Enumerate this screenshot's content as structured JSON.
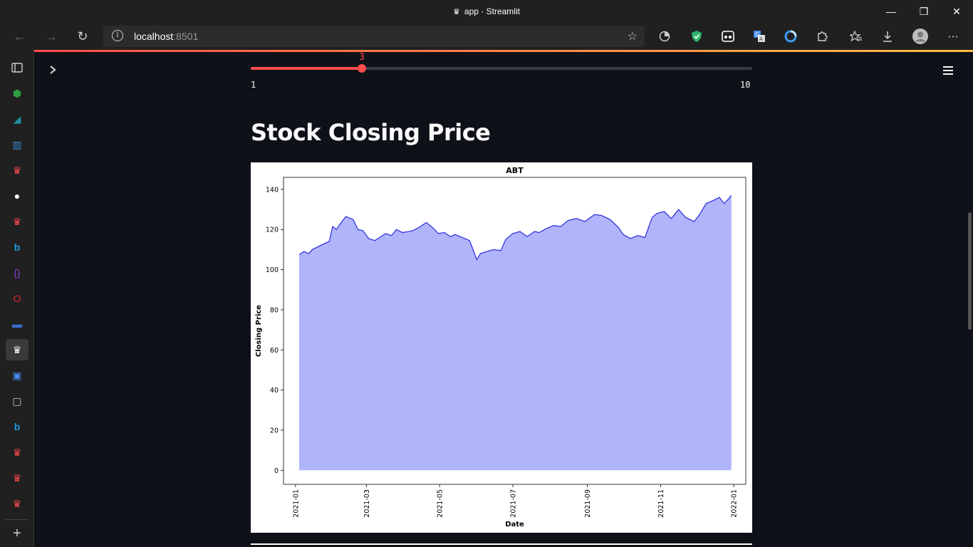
{
  "window": {
    "title": "app · Streamlit",
    "minimize_label": "—",
    "restore_label": "❐",
    "close_label": "✕"
  },
  "toolbar": {
    "back_icon": "←",
    "forward_icon": "→",
    "reload_icon": "↻",
    "url_host": "localhost",
    "url_port": ":8501",
    "favorite_icon": "☆",
    "more_icon": "⋯"
  },
  "slider": {
    "value": "3",
    "min": "1",
    "max": "10",
    "value_num": 3,
    "min_num": 1,
    "max_num": 10,
    "color": "#ff4b4b"
  },
  "page": {
    "heading": "Stock Closing Price"
  },
  "chart_data": {
    "type": "area",
    "title": "ABT",
    "xlabel": "Date",
    "ylabel": "Closing Price",
    "ylim": [
      -7,
      146
    ],
    "y_ticks": [
      0,
      20,
      40,
      60,
      80,
      100,
      120,
      140
    ],
    "x_ticks": [
      "2021-01",
      "2021-03",
      "2021-05",
      "2021-07",
      "2021-09",
      "2021-11",
      "2022-01"
    ],
    "x_tick_days": [
      0,
      59,
      120,
      181,
      243,
      304,
      365
    ],
    "fill_color": "#b0b4fb",
    "line_color": "#2b2bdd",
    "grid": false,
    "series": [
      {
        "x": [
          "2021-01-04",
          "2021-01-08",
          "2021-01-12",
          "2021-01-15",
          "2021-01-20",
          "2021-01-25",
          "2021-01-29",
          "2021-02-01",
          "2021-02-04",
          "2021-02-08",
          "2021-02-12",
          "2021-02-18",
          "2021-02-22",
          "2021-02-26",
          "2021-03-03",
          "2021-03-08",
          "2021-03-12",
          "2021-03-17",
          "2021-03-22",
          "2021-03-26",
          "2021-03-31",
          "2021-04-05",
          "2021-04-09",
          "2021-04-15",
          "2021-04-20",
          "2021-04-26",
          "2021-04-30",
          "2021-05-05",
          "2021-05-10",
          "2021-05-14",
          "2021-05-20",
          "2021-05-26",
          "2021-06-01",
          "2021-06-04",
          "2021-06-09",
          "2021-06-15",
          "2021-06-21",
          "2021-06-25",
          "2021-07-01",
          "2021-07-07",
          "2021-07-13",
          "2021-07-19",
          "2021-07-23",
          "2021-07-29",
          "2021-08-04",
          "2021-08-10",
          "2021-08-16",
          "2021-08-23",
          "2021-08-30",
          "2021-09-07",
          "2021-09-13",
          "2021-09-20",
          "2021-09-27",
          "2021-10-01",
          "2021-10-07",
          "2021-10-13",
          "2021-10-19",
          "2021-10-25",
          "2021-10-29",
          "2021-11-04",
          "2021-11-10",
          "2021-11-16",
          "2021-11-22",
          "2021-11-29",
          "2021-12-03",
          "2021-12-09",
          "2021-12-15",
          "2021-12-20",
          "2021-12-24",
          "2021-12-28",
          "2021-12-30"
        ],
        "values": [
          107.5,
          109,
          108,
          110,
          111.5,
          113,
          114,
          121.5,
          120,
          123.5,
          126.5,
          125,
          120,
          119.5,
          115.5,
          114.5,
          116,
          118,
          117,
          120,
          118.5,
          119,
          119.5,
          121.5,
          123.5,
          120.5,
          118,
          118.5,
          116.5,
          117.5,
          116,
          114.5,
          105,
          108,
          109,
          110,
          109.5,
          115,
          118,
          119,
          116.5,
          119,
          118.5,
          120.5,
          122,
          121.5,
          124.5,
          125.5,
          124,
          127.5,
          127,
          125,
          121,
          117.5,
          115.5,
          117,
          116,
          126,
          128,
          129,
          125.5,
          130,
          126,
          124,
          127,
          133,
          134.5,
          136,
          133,
          135.5,
          137
        ]
      }
    ]
  }
}
